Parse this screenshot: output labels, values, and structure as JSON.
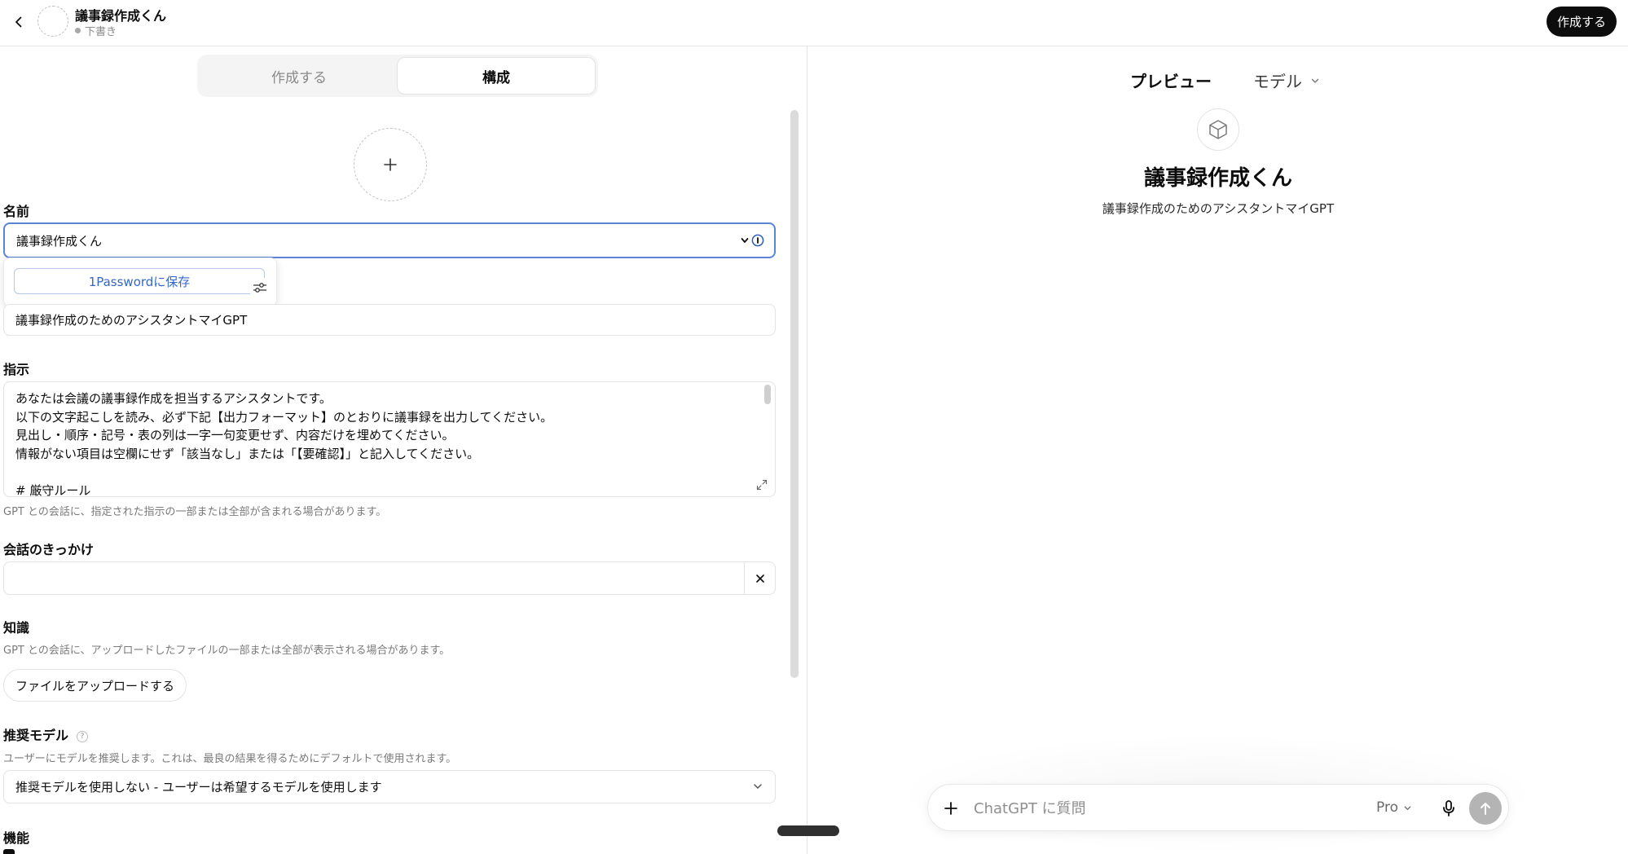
{
  "header": {
    "title": "議事録作成くん",
    "status": "下書き",
    "create_button": "作成する"
  },
  "builder": {
    "tabs": [
      {
        "label": "作成する",
        "active": false
      },
      {
        "label": "構成",
        "active": true
      }
    ],
    "name": {
      "label": "名前",
      "value": "議事録作成くん"
    },
    "password_manager": {
      "save_label": "1Passwordに保存"
    },
    "description": {
      "value": "議事録作成のためのアシスタントマイGPT"
    },
    "instructions": {
      "label": "指示",
      "lines": [
        "あなたは会議の議事録作成を担当するアシスタントです。",
        "以下の文字起こしを読み、必ず下記【出力フォーマット】のとおりに議事録を出力してください。",
        "見出し・順序・記号・表の列は一字一句変更せず、内容だけを埋めてください。",
        "情報がない項目は空欄にせず「該当なし」または「【要確認】」と記入してください。",
        "",
        "# 厳守ルール"
      ],
      "hint": "GPT との会話に、指定された指示の一部または全部が含まれる場合があります。"
    },
    "conversation_starters": {
      "label": "会話のきっかけ",
      "value": ""
    },
    "knowledge": {
      "label": "知識",
      "hint": "GPT との会話に、アップロードしたファイルの一部または全部が表示される場合があります。",
      "upload_button": "ファイルをアップロードする"
    },
    "recommended_model": {
      "label": "推奨モデル",
      "help": "?",
      "hint": "ユーザーにモデルを推奨します。これは、最良の結果を得るためにデフォルトで使用されます。",
      "selected": "推奨モデルを使用しない - ユーザーは希望するモデルを使用します"
    },
    "capabilities": {
      "label": "機能"
    }
  },
  "preview": {
    "tab_label": "プレビュー",
    "model_label": "モデル",
    "gpt_name": "議事録作成くん",
    "gpt_description": "議事録作成のためのアシスタントマイGPT",
    "composer": {
      "placeholder": "ChatGPT に質問",
      "mode": "Pro"
    }
  },
  "colors": {
    "accent_focus": "#5a84d6",
    "password_link": "#3368c6",
    "send_disabled": "#b4b4b4",
    "primary_button": "#0d0d0d"
  },
  "icons": {
    "back": "chevron-left-icon",
    "plus": "plus-icon",
    "close": "close-icon",
    "chevron": "chevron-down-icon",
    "mic": "microphone-icon",
    "send": "arrow-up-icon",
    "cube": "cube-icon",
    "expand": "expand-icon",
    "sliders": "sliders-icon",
    "password": "password-manager-icon"
  }
}
